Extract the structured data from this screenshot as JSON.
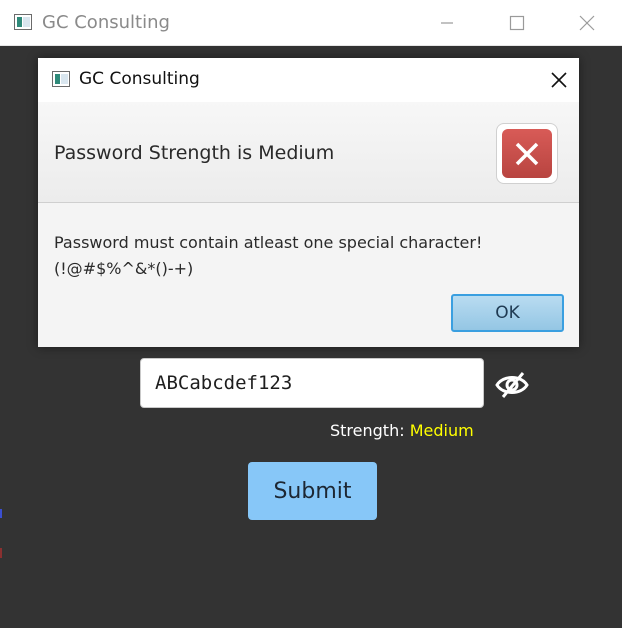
{
  "app": {
    "title": "GC Consulting"
  },
  "form": {
    "password_value": "ABCabcdef123",
    "strength_label": "Strength:",
    "strength_value": "Medium",
    "submit_label": "Submit"
  },
  "dialog": {
    "title": "GC Consulting",
    "header": "Password Strength is Medium",
    "content_line1": "Password must contain atleast one special character!",
    "content_line2": "(!@#$%^&*()-+)",
    "ok_label": "OK",
    "icon": "error-icon"
  },
  "colors": {
    "window_bg": "#333333",
    "strength_medium": "#ffff00",
    "submit_bg": "#87c7f8",
    "error_red": "#c9504c",
    "ok_focus_border": "#3a9fe0"
  }
}
